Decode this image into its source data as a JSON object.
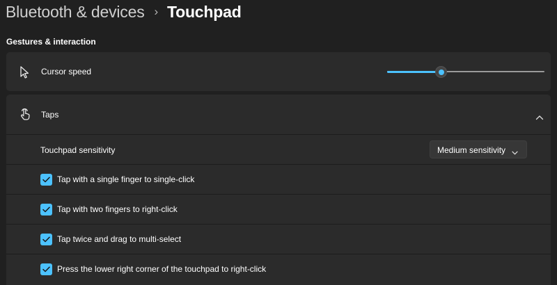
{
  "header": {
    "parent": "Bluetooth & devices",
    "separator": "›",
    "current": "Touchpad"
  },
  "section": {
    "title": "Gestures & interaction"
  },
  "cursor_speed": {
    "label": "Cursor speed",
    "icon": "cursor-arrow-icon",
    "value_fraction": 0.34
  },
  "taps": {
    "label": "Taps",
    "icon": "tap-hand-icon",
    "expanded": true,
    "sensitivity": {
      "label": "Touchpad sensitivity",
      "selected": "Medium sensitivity"
    },
    "options": [
      {
        "label": "Tap with a single finger to single-click",
        "checked": true
      },
      {
        "label": "Tap with two fingers to right-click",
        "checked": true
      },
      {
        "label": "Tap twice and drag to multi-select",
        "checked": true
      },
      {
        "label": "Press the lower right corner of the touchpad to right-click",
        "checked": true
      }
    ]
  },
  "colors": {
    "background": "#202020",
    "card": "#2b2b2b",
    "accent": "#4cc2ff"
  }
}
